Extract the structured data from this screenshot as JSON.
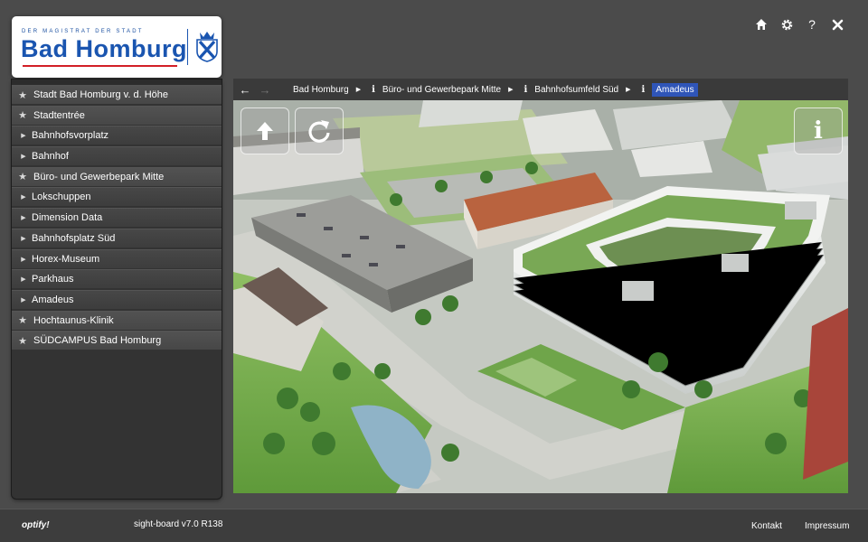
{
  "logo": {
    "tagline": "DER MAGISTRAT DER STADT",
    "name": "Bad Homburg",
    "colors": {
      "blue": "#1a55b0",
      "red": "#d21f26"
    }
  },
  "toolbar": {
    "icons": [
      "home-icon",
      "gear-icon",
      "help-icon",
      "close-icon"
    ],
    "help_label": "?"
  },
  "sidebar": {
    "items": [
      {
        "label": "Stadt Bad Homburg v. d. Höhe",
        "type": "star"
      },
      {
        "label": "Stadtentrée",
        "type": "star"
      },
      {
        "label": "Bahnhofsvorplatz",
        "type": "sub"
      },
      {
        "label": "Bahnhof",
        "type": "sub"
      },
      {
        "label": "Büro- und Gewerbepark Mitte",
        "type": "star"
      },
      {
        "label": "Lokschuppen",
        "type": "sub"
      },
      {
        "label": "Dimension Data",
        "type": "sub"
      },
      {
        "label": "Bahnhofsplatz Süd",
        "type": "sub"
      },
      {
        "label": "Horex-Museum",
        "type": "sub"
      },
      {
        "label": "Parkhaus",
        "type": "sub"
      },
      {
        "label": "Amadeus",
        "type": "sub"
      },
      {
        "label": "Hochtaunus-Klinik",
        "type": "star"
      },
      {
        "label": "SÜDCAMPUS Bad Homburg",
        "type": "star"
      }
    ]
  },
  "breadcrumb": {
    "items": [
      {
        "label": "Bad Homburg",
        "info": false,
        "active": false
      },
      {
        "label": "Büro- und Gewerbepark Mitte",
        "info": true,
        "active": false
      },
      {
        "label": "Bahnhofsumfeld Süd",
        "info": true,
        "active": false
      },
      {
        "label": "Amadeus",
        "info": true,
        "active": true
      }
    ],
    "active_color": "#2f55b8"
  },
  "viewer": {
    "buttons": [
      "up-arrow-icon",
      "rotate-icon",
      "info-icon"
    ],
    "info_glyph": "i"
  },
  "footer": {
    "brand": "optify!",
    "version": "sight-board v7.0 R138",
    "links": [
      "Kontakt",
      "Impressum"
    ]
  }
}
